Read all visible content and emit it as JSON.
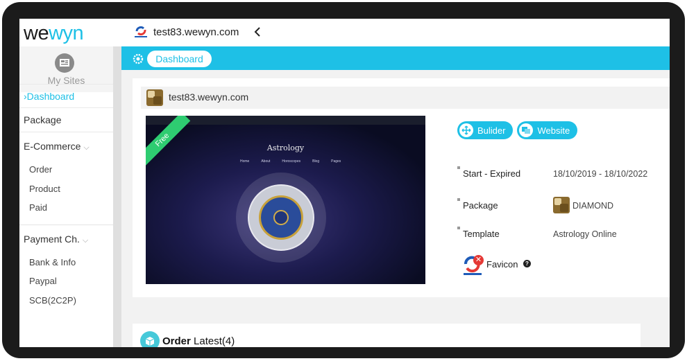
{
  "brand": {
    "logo_a": "we",
    "logo_b": "wyn"
  },
  "header": {
    "site_name": "test83.wewyn.com"
  },
  "sidebar": {
    "mysites_label": "My Sites",
    "items": [
      {
        "label": "Dashboard"
      },
      {
        "label": "Package"
      }
    ],
    "ecommerce": {
      "label": "E-Commerce",
      "children": [
        "Order",
        "Product",
        "Paid"
      ]
    },
    "payment": {
      "label": "Payment Ch.",
      "children": [
        "Bank & Info",
        "Paypal",
        "SCB(2C2P)"
      ]
    }
  },
  "breadcrumb": {
    "label": "Dashboard"
  },
  "site_card": {
    "title": "test83.wewyn.com",
    "ribbon": "Free",
    "preview_title": "Astrology",
    "preview_nav": [
      "Home",
      "About",
      "Horoscopes",
      "Blog",
      "Pages"
    ],
    "builder_label": "Bulider",
    "website_label": "Website",
    "start_expired_label": "Start - Expired",
    "start_expired_value": "18/10/2019 - 18/10/2022",
    "package_label": "Package",
    "package_value": "DIAMOND",
    "template_label": "Template",
    "template_value": "Astrology Online",
    "favicon_label": "Favicon"
  },
  "orders": {
    "title_bold": "Order",
    "title_rest": " Latest(4)"
  },
  "colors": {
    "accent": "#1ec0e6",
    "ribbon": "#2ecc71",
    "remove": "#e53935"
  }
}
